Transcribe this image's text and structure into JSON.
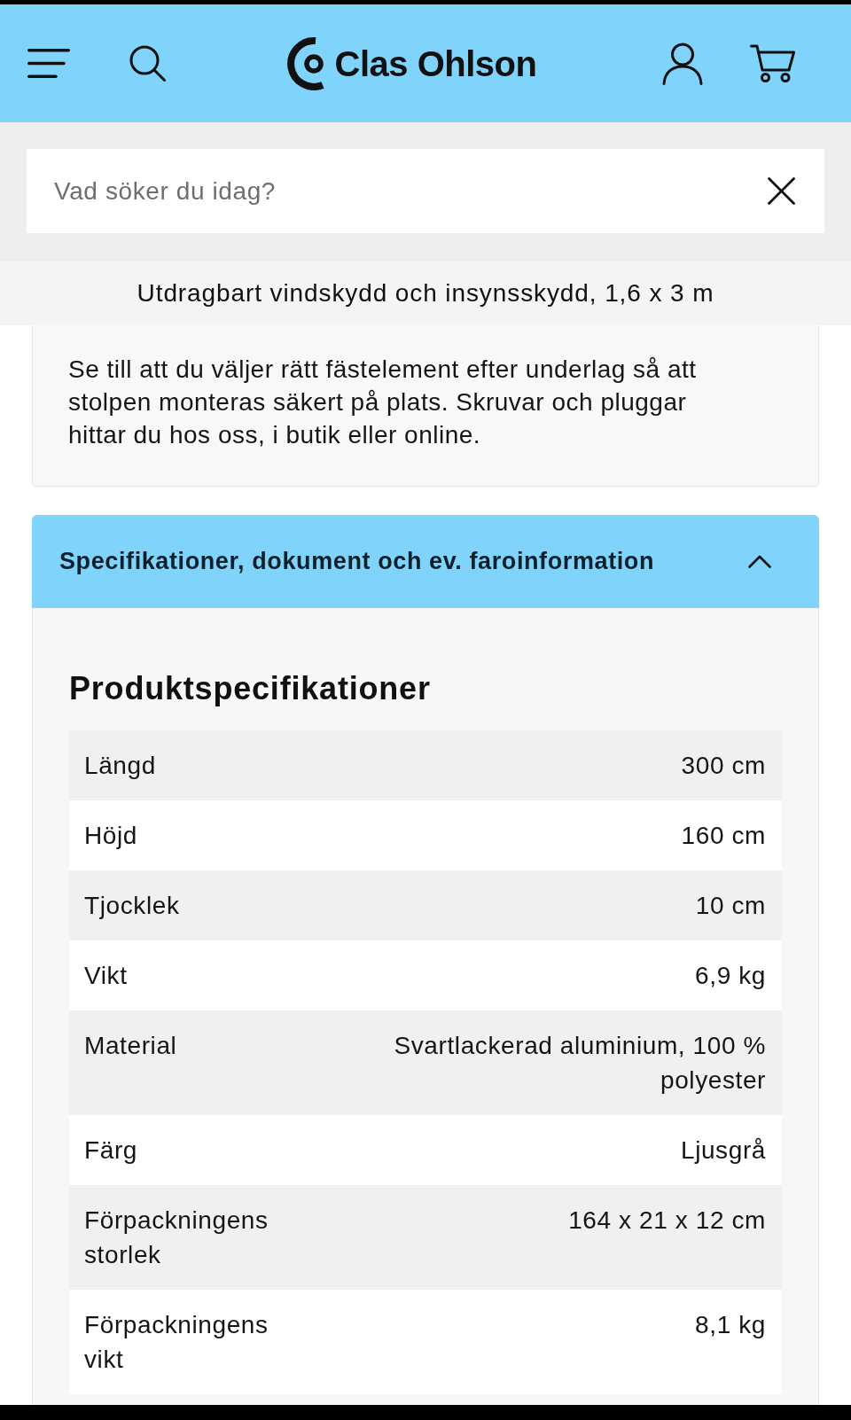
{
  "header": {
    "logo_text": "Clas Ohlson"
  },
  "search": {
    "placeholder": "Vad söker du idag?"
  },
  "product_title": "Utdragbart vindskydd och insynsskydd, 1,6 x 3 m",
  "info_card": {
    "text": "Se till att du väljer rätt fästelement efter underlag så att stolpen monteras säkert på plats. Skruvar och pluggar hittar du hos oss, i butik eller online."
  },
  "accordion": {
    "title": "Specifikationer, dokument och ev. faroinformation",
    "expanded": true,
    "heading": "Produktspecifikationer",
    "rows": [
      {
        "label": "Längd",
        "value": "300 cm"
      },
      {
        "label": "Höjd",
        "value": "160 cm"
      },
      {
        "label": "Tjocklek",
        "value": "10 cm"
      },
      {
        "label": "Vikt",
        "value": "6,9 kg"
      },
      {
        "label": "Material",
        "value": "Svartlackerad aluminium, 100 % polyester"
      },
      {
        "label": "Färg",
        "value": "Ljusgrå"
      },
      {
        "label": "Förpackningens storlek",
        "value": "164 x 21 x 12 cm"
      },
      {
        "label": "Förpackningens vikt",
        "value": "8,1 kg"
      }
    ]
  }
}
